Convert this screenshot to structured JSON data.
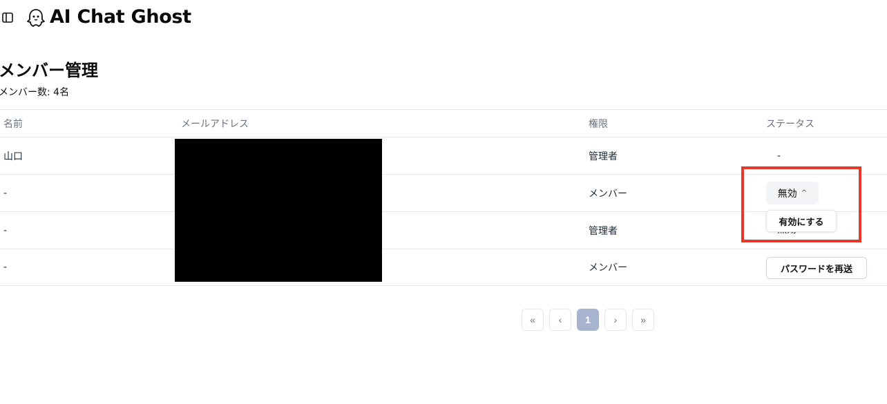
{
  "app": {
    "title": "AI Chat Ghost",
    "logo_icon": "ghost-icon",
    "sidebar_icon": "sidebar-toggle-icon"
  },
  "page": {
    "title": "メンバー管理",
    "member_count": "メンバー数: 4名"
  },
  "table": {
    "headers": {
      "name": "名前",
      "email": "メールアドレス",
      "role": "権限",
      "status": "ステータス"
    },
    "rows": [
      {
        "name": "山口",
        "role": "管理者",
        "status": "-"
      },
      {
        "name": "-",
        "role": "メンバー",
        "status": "無効"
      },
      {
        "name": "-",
        "role": "管理者",
        "status": "無効"
      },
      {
        "name": "-",
        "role": "メンバー",
        "status": "パスワードを再送"
      }
    ]
  },
  "dropdown": {
    "option": "有効にする"
  },
  "pagination": {
    "first": "«",
    "prev": "‹",
    "current": "1",
    "next": "›",
    "last": "»"
  },
  "colors": {
    "highlight": "#e53a2b",
    "active_page": "#a6b4cf"
  }
}
